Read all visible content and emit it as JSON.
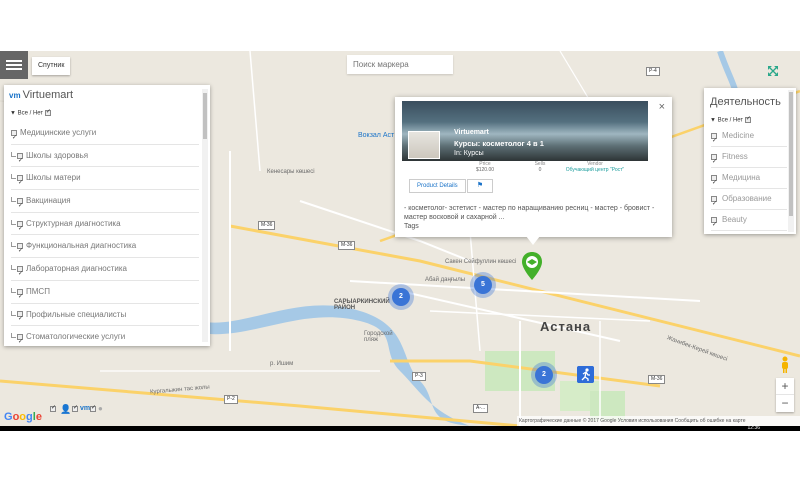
{
  "toolbar": {
    "satellite_label": "Спутник",
    "search_placeholder": "Поиск маркера"
  },
  "left_panel": {
    "title": "Virtuemart",
    "logo": "vm",
    "all_none": "Все / Нет",
    "categories": [
      {
        "label": "Медицинские услуги"
      },
      {
        "label": "Школы здоровья"
      },
      {
        "label": "Школы матери"
      },
      {
        "label": "Вакцинация"
      },
      {
        "label": "Структурная диагностика"
      },
      {
        "label": "Функциональная диагностика"
      },
      {
        "label": "Лабораторная диагностика"
      },
      {
        "label": "ПМСП"
      },
      {
        "label": "Профильные специалисты"
      },
      {
        "label": "Стоматологические услуги"
      }
    ]
  },
  "right_panel": {
    "title": "Деятельность",
    "all_none": "Все / Нет",
    "items": [
      {
        "label": "Medicine"
      },
      {
        "label": "Fitness"
      },
      {
        "label": "Медицина"
      },
      {
        "label": "Образование"
      },
      {
        "label": "Beauty"
      }
    ]
  },
  "popup": {
    "vendor": "Virtuemart",
    "product_name": "Курсы: косметолог 4 в 1",
    "category": "In: Курсы",
    "stats": [
      {
        "label": "Price",
        "value": "$120.00"
      },
      {
        "label": "Sells",
        "value": "0"
      },
      {
        "label": "Vendor",
        "value": "Обучающий центр \"Рост\""
      }
    ],
    "details_button": "Product Details",
    "description": "- косметолог- эстетист - мастер по наращиванию ресниц - мастер - бровист - мастер восковой и сахарной ...",
    "tags": "Tags",
    "close": "×"
  },
  "map": {
    "city": "Астана",
    "district": "САРЫАРКИНСКИЙ РАЙОН",
    "beach": "Городской пляж",
    "station": "Вокзал Аст",
    "clusters": [
      {
        "count": "2"
      },
      {
        "count": "5"
      },
      {
        "count": "2"
      }
    ],
    "roads": [
      "P-4",
      "M-36",
      "M-36",
      "P-3",
      "M-36",
      "P-2",
      "A-..."
    ],
    "street_labels": [
      "Кенесары көшесі",
      "Сакен Сейфуллин көшесі",
      "Абай даңғылы",
      "Кургальжин тас жолы",
      "Жанибек-Керей көшесі",
      "р. Ишим"
    ]
  },
  "footer": {
    "google": "Google",
    "attribution": "Картографические данные © 2017 Google   Условия использования   Сообщить об ошибке на карте",
    "zoom_in": "+",
    "zoom_out": "−",
    "time": "12:36"
  },
  "colors": {
    "accent": "#1a73c8",
    "cluster": "#3a74d6",
    "green_pin": "#43b02a",
    "menu_bg": "#666666"
  }
}
